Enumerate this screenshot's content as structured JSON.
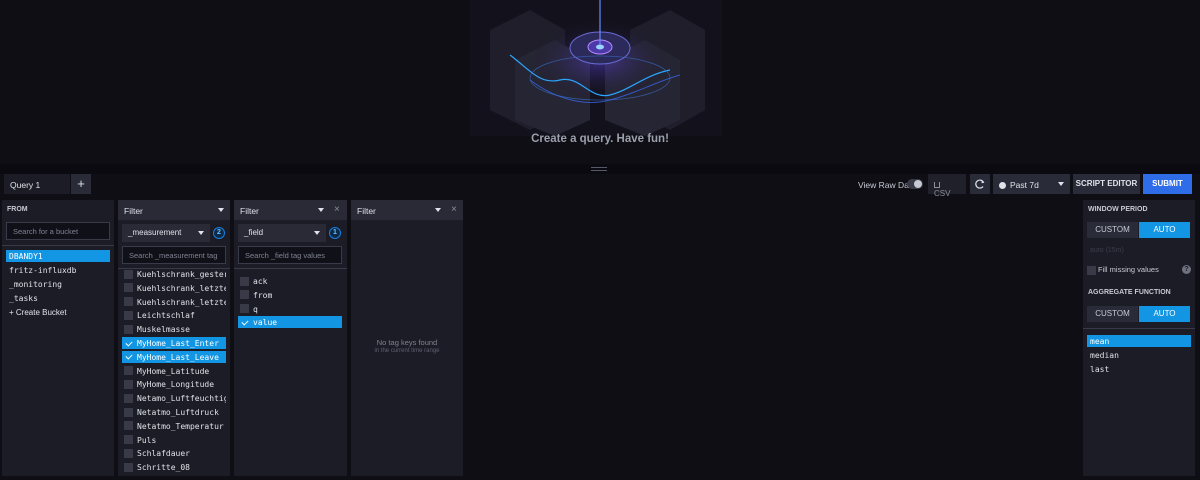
{
  "graph": {
    "empty_message": "Create a query. Have fun!"
  },
  "toolbar": {
    "query_tab": "Query 1",
    "add_tab": "+",
    "view_raw_label": "View Raw Data",
    "view_raw_on": false,
    "csv_label": "CSV",
    "time_range": "Past 7d",
    "script_editor": "SCRIPT EDITOR",
    "submit": "SUBMIT"
  },
  "from_panel": {
    "title": "FROM",
    "search_placeholder": "Search for a bucket",
    "buckets": [
      "DBANDY1",
      "fritz-influxdb",
      "_monitoring",
      "_tasks"
    ],
    "selected_bucket": "DBANDY1",
    "create_label": "+ Create Bucket"
  },
  "filter1": {
    "title": "Filter",
    "key": "_measurement",
    "count": "2",
    "search_placeholder": "Search _measurement tag",
    "items": [
      {
        "label": "Kuehlschrank_gestern",
        "checked": false
      },
      {
        "label": "Kuehlschrank_letzte...",
        "checked": false
      },
      {
        "label": "Kuehlschrank_letzte...",
        "checked": false
      },
      {
        "label": "Leichtschlaf",
        "checked": false
      },
      {
        "label": "Muskelmasse",
        "checked": false
      },
      {
        "label": "MyHome_Last_Enter",
        "checked": true
      },
      {
        "label": "MyHome_Last_Leave",
        "checked": true
      },
      {
        "label": "MyHome_Latitude",
        "checked": false
      },
      {
        "label": "MyHome_Longitude",
        "checked": false
      },
      {
        "label": "Netamo_Luftfeuchtig...",
        "checked": false
      },
      {
        "label": "Netatmo_Luftdruck",
        "checked": false
      },
      {
        "label": "Netatmo_Temperatur",
        "checked": false
      },
      {
        "label": "Puls",
        "checked": false
      },
      {
        "label": "Schlafdauer",
        "checked": false
      },
      {
        "label": "Schritte_08",
        "checked": false
      }
    ]
  },
  "filter2": {
    "title": "Filter",
    "close": "×",
    "key": "_field",
    "count": "1",
    "search_placeholder": "Search _field tag values",
    "items": [
      {
        "label": "ack",
        "checked": false
      },
      {
        "label": "from",
        "checked": false
      },
      {
        "label": "q",
        "checked": false
      },
      {
        "label": "value",
        "checked": true
      }
    ]
  },
  "filter3": {
    "title": "Filter",
    "close": "×",
    "empty_title": "No tag keys found",
    "empty_sub": "in the current time range"
  },
  "aggregate": {
    "window_title": "WINDOW PERIOD",
    "custom": "CUSTOM",
    "auto": "AUTO",
    "window_mode": "AUTO",
    "window_value": "auto (15m)",
    "fill_missing": "Fill missing values",
    "fill_checked": false,
    "help": "?",
    "function_title": "AGGREGATE FUNCTION",
    "function_mode": "AUTO",
    "functions": [
      "mean",
      "median",
      "last"
    ],
    "selected_function": "mean"
  },
  "colors": {
    "accent": "#1295e3",
    "submit": "#2f6ce8",
    "panel": "#1c1c26",
    "background": "#0f0e15"
  }
}
